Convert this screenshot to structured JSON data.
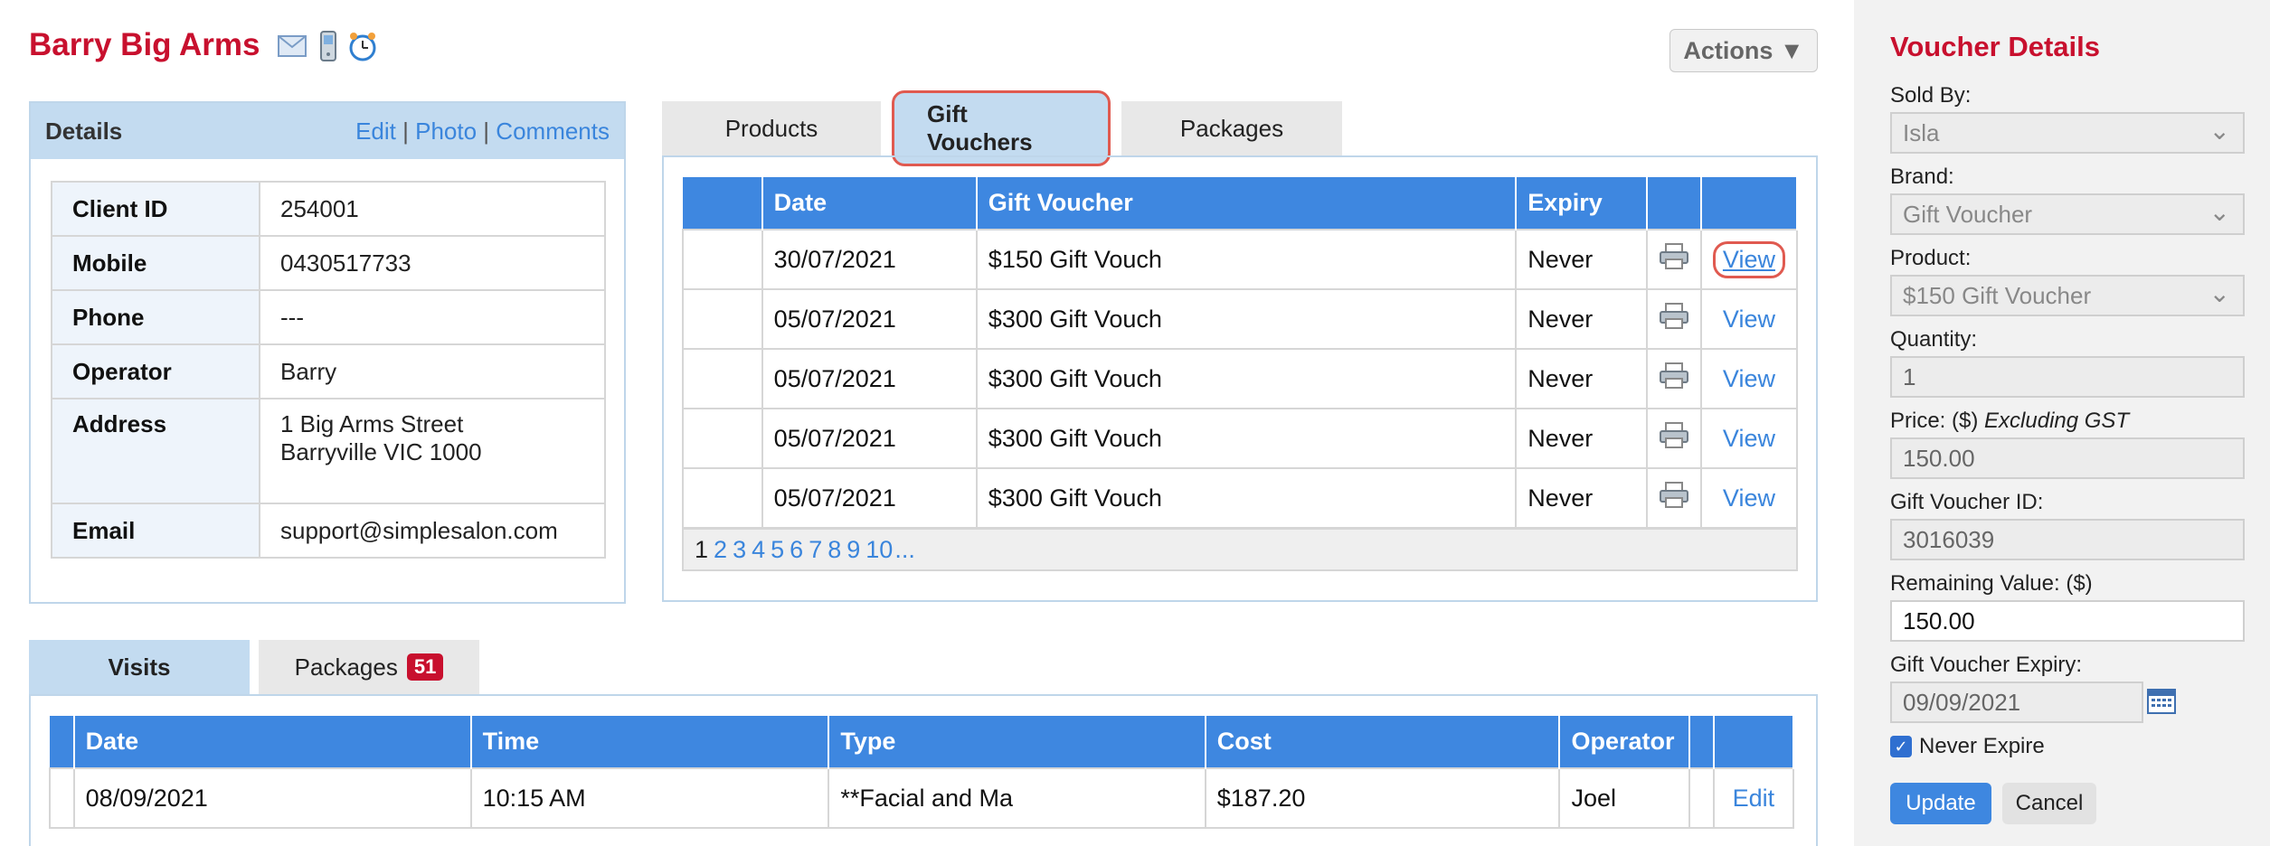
{
  "client": {
    "name": "Barry Big Arms"
  },
  "header_icons": [
    "email-icon",
    "mobile-phone-icon",
    "alarm-clock-icon"
  ],
  "actions": {
    "label": "Actions ▼"
  },
  "details": {
    "title": "Details",
    "edit": "Edit",
    "photo": "Photo",
    "comments": "Comments",
    "sep": "|",
    "rows": [
      {
        "label": "Client ID",
        "value": "254001"
      },
      {
        "label": "Mobile",
        "value": "0430517733"
      },
      {
        "label": "Phone",
        "value": "---"
      },
      {
        "label": "Operator",
        "value": "Barry"
      },
      {
        "label": "Address",
        "value": "1 Big Arms Street",
        "value2": "Barryville VIC 1000"
      },
      {
        "label": "Email",
        "value": "support@simplesalon.com"
      }
    ]
  },
  "top_tabs": {
    "products": "Products",
    "gift_vouchers": "Gift Vouchers",
    "packages": "Packages"
  },
  "vouchers": {
    "headers": [
      "",
      "Date",
      "Gift Voucher",
      "Expiry",
      "",
      ""
    ],
    "view_label": "View",
    "rows": [
      {
        "date": "30/07/2021",
        "voucher": "$150 Gift Vouch",
        "expiry": "Never"
      },
      {
        "date": "05/07/2021",
        "voucher": "$300 Gift Vouch",
        "expiry": "Never"
      },
      {
        "date": "05/07/2021",
        "voucher": "$300 Gift Vouch",
        "expiry": "Never"
      },
      {
        "date": "05/07/2021",
        "voucher": "$300 Gift Vouch",
        "expiry": "Never"
      },
      {
        "date": "05/07/2021",
        "voucher": "$300 Gift Vouch",
        "expiry": "Never"
      }
    ],
    "pager": {
      "current": "1",
      "pages": [
        "2",
        "3",
        "4",
        "5",
        "6",
        "7",
        "8",
        "9",
        "10"
      ],
      "more": "..."
    }
  },
  "bottom_tabs": {
    "visits": "Visits",
    "packages": "Packages",
    "packages_badge": "51"
  },
  "visits": {
    "headers": [
      "",
      "Date",
      "Time",
      "Type",
      "Cost",
      "Operator",
      "",
      ""
    ],
    "edit_label": "Edit",
    "rows": [
      {
        "date": "08/09/2021",
        "time": "10:15 AM",
        "type": "**Facial and Ma",
        "cost": "$187.20",
        "operator": "Joel"
      }
    ]
  },
  "voucher_details": {
    "title": "Voucher Details",
    "sold_by_label": "Sold By:",
    "sold_by": "Isla",
    "brand_label": "Brand:",
    "brand": "Gift Voucher",
    "product_label": "Product:",
    "product": "$150 Gift Voucher",
    "quantity_label": "Quantity:",
    "quantity": "1",
    "price_label": "Price: ($)",
    "price_note": "Excluding GST",
    "price": "150.00",
    "voucher_id_label": "Gift Voucher ID:",
    "voucher_id": "3016039",
    "remaining_label": "Remaining Value: ($)",
    "remaining": "150.00",
    "expiry_label": "Gift Voucher Expiry:",
    "expiry": "09/09/2021",
    "never_expire_label": "Never Expire",
    "never_expire": true,
    "update": "Update",
    "cancel": "Cancel"
  },
  "colors": {
    "brand_red": "#c8102e",
    "header_blue": "#3e87e0",
    "link_blue": "#3a85dc",
    "highlight": "#e05a50"
  }
}
